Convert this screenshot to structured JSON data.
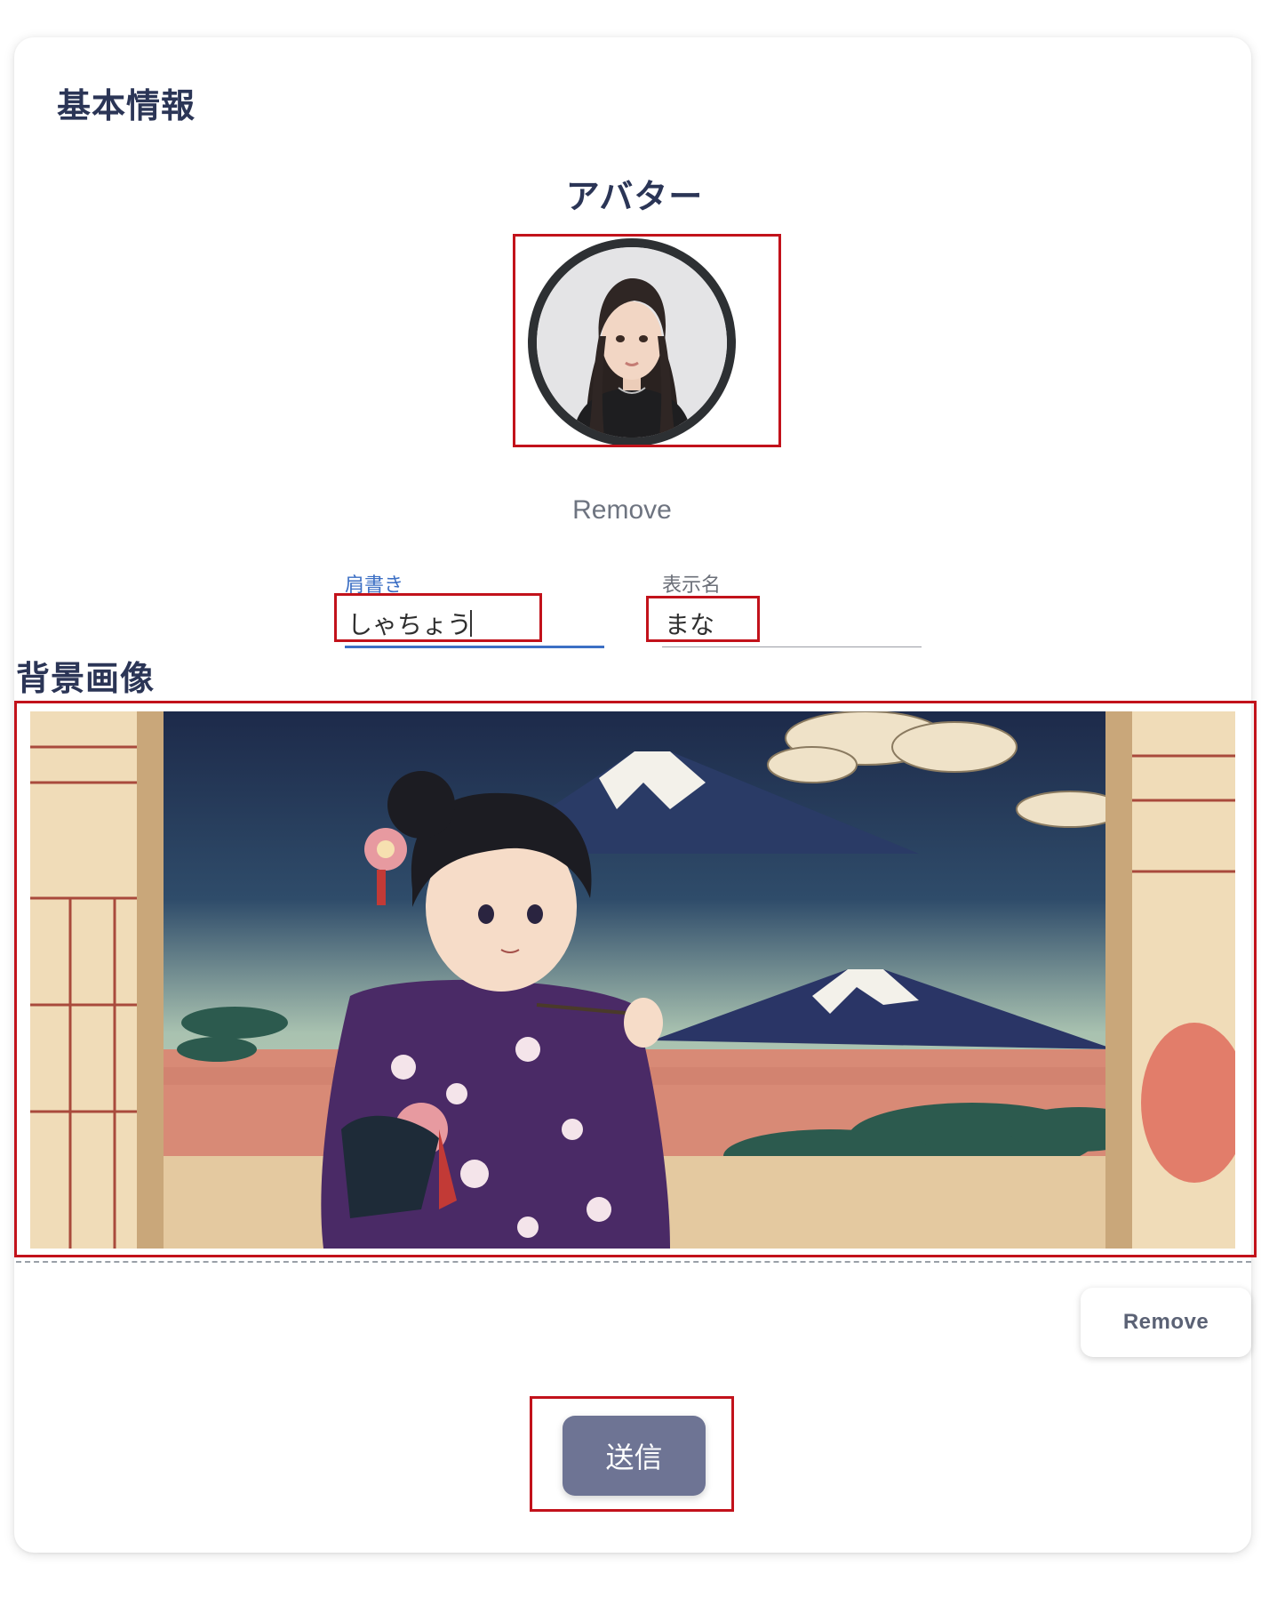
{
  "card": {
    "title": "基本情報"
  },
  "avatar": {
    "title": "アバター",
    "remove_label": "Remove"
  },
  "fields": {
    "title_field": {
      "label": "肩書き",
      "value": "しゃちょう"
    },
    "display_name_field": {
      "label": "表示名",
      "value": "まな"
    }
  },
  "background": {
    "title": "背景画像",
    "remove_label": "Remove"
  },
  "submit": {
    "label": "送信"
  },
  "colors": {
    "accent": "#3c6fc4",
    "title_text": "#2b3556",
    "highlight": "#c2121b",
    "submit_bg": "#6e7494"
  }
}
